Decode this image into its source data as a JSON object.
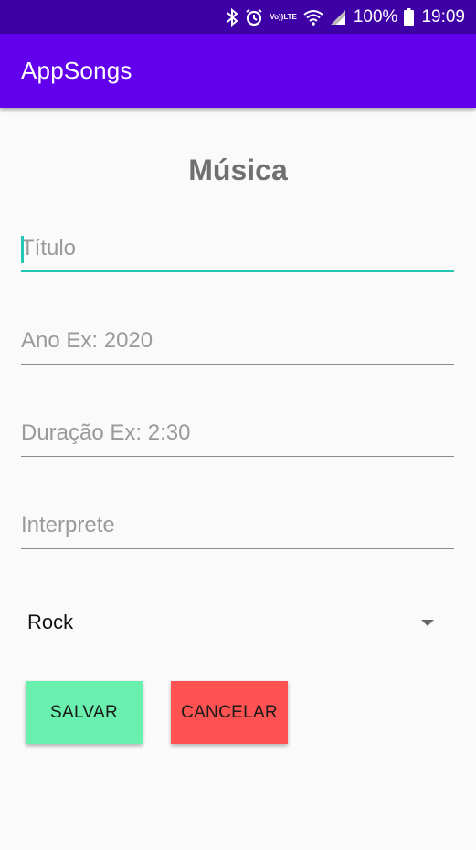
{
  "status_bar": {
    "icons": [
      "bluetooth-icon",
      "alarm-icon",
      "volte-icon",
      "wifi-icon",
      "signal-icon",
      "battery-icon"
    ],
    "volte_top": "Vo))",
    "volte_bottom": "LTE",
    "battery_percent": "100%",
    "time": "19:09"
  },
  "app_bar": {
    "title": "AppSongs"
  },
  "form": {
    "heading": "Música",
    "title_placeholder": "Título",
    "title_value": "",
    "year_placeholder": "Ano Ex: 2020",
    "year_value": "",
    "duration_placeholder": "Duração Ex: 2:30",
    "duration_value": "",
    "artist_placeholder": "Interprete",
    "artist_value": "",
    "genre_selected": "Rock"
  },
  "buttons": {
    "save_label": "SALVAR",
    "cancel_label": "CANCELAR"
  },
  "colors": {
    "status_bar": "#3e01a6",
    "app_bar": "#6200ee",
    "accent": "#26c6b4",
    "save_button": "#69f0ae",
    "cancel_button": "#ff5252",
    "heading_text": "#707070"
  }
}
